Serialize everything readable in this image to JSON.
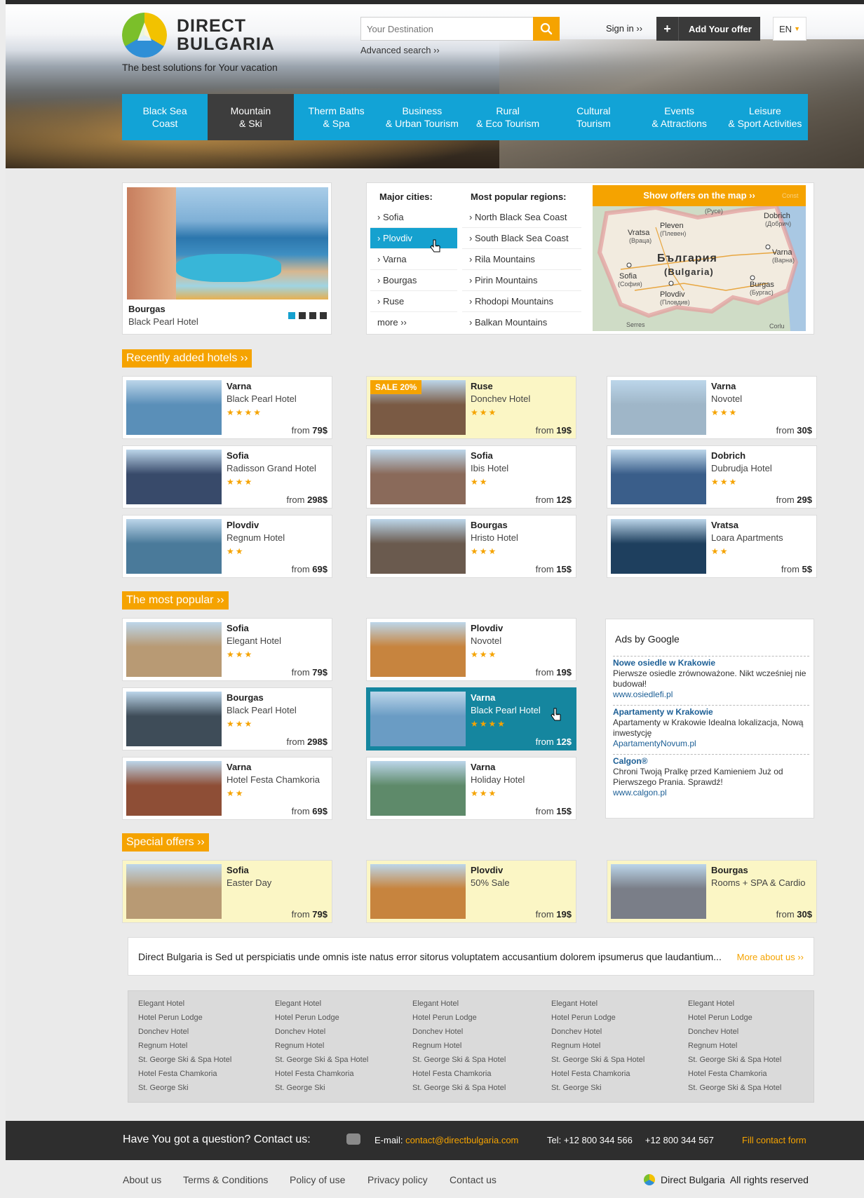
{
  "header": {
    "brand_line1": "DIRECT",
    "brand_line2": "BULGARIA",
    "tagline": "The best solutions for Your vacation",
    "search_placeholder": "Your Destination",
    "advanced_search": "Advanced search ››",
    "sign_in": "Sign in ››",
    "add_offer": "Add Your offer",
    "language": "EN"
  },
  "nav": [
    {
      "line1": "Black Sea",
      "line2": "Coast"
    },
    {
      "line1": "Mountain",
      "line2": "& Ski"
    },
    {
      "line1": "Therm Baths",
      "line2": "& Spa"
    },
    {
      "line1": "Business",
      "line2": "& Urban Tourism"
    },
    {
      "line1": "Rural",
      "line2": "& Eco Tourism"
    },
    {
      "line1": "Cultural",
      "line2": "Tourism"
    },
    {
      "line1": "Events",
      "line2": "& Attractions"
    },
    {
      "line1": "Leisure",
      "line2": "& Sport Activities"
    }
  ],
  "featured": {
    "city": "Bourgas",
    "hotel": "Black Pearl Hotel",
    "slides": 4,
    "active_slide": 1
  },
  "cities": {
    "heading": "Major cities:",
    "items": [
      "› Sofia",
      "› Plovdiv",
      "› Varna",
      "› Bourgas",
      "› Ruse",
      "more ››"
    ],
    "selected": "› Plovdiv"
  },
  "regions": {
    "heading": "Most popular regions:",
    "items": [
      "› North Black Sea Coast",
      "› South Black Sea Coast",
      "› Rila Mountains",
      "› Pirin Mountains",
      "› Rhodopi Mountains",
      "› Balkan Mountains"
    ]
  },
  "map": {
    "button": "Show offers on the map ››",
    "country": "България",
    "country_en": "(Bulgaria)",
    "labels": [
      "Pleven",
      "(Плевен)",
      "Vratsa",
      "(Враца)",
      "Dobrich",
      "(Добрич)",
      "Varna",
      "(Варна)",
      "Sofia",
      "(София)",
      "Plovdiv",
      "(Пловдив)",
      "Burgas",
      "(Бургас)",
      "Serres",
      "Corlu",
      "(Русе)",
      "Const"
    ]
  },
  "sections": {
    "recent": "Recently added hotels ››",
    "popular": "The most popular ››",
    "special": "Special offers ››"
  },
  "recent_hotels": [
    {
      "city": "Varna",
      "name": "Black Pearl Hotel",
      "stars": "★★★★",
      "from": "from ",
      "price": "79$",
      "bg": "#5a8fb8"
    },
    {
      "city": "Ruse",
      "name": "Donchev Hotel",
      "stars": "★★★",
      "from": "from ",
      "price": "19$",
      "badge": "SALE 20%",
      "bg": "#7a5a44"
    },
    {
      "city": "Varna",
      "name": "Novotel",
      "stars": "★★★",
      "from": "from ",
      "price": "30$",
      "bg": "#9fb6c8"
    },
    {
      "city": "Sofia",
      "name": "Radisson Grand Hotel",
      "stars": "★★★",
      "from": "from ",
      "price": "298$",
      "bg": "#384a6a"
    },
    {
      "city": "Sofia",
      "name": "Ibis Hotel",
      "stars": "★★",
      "from": "from ",
      "price": "12$",
      "bg": "#8a6a5a"
    },
    {
      "city": "Dobrich",
      "name": "Dubrudja Hotel",
      "stars": "★★★",
      "from": "from ",
      "price": "29$",
      "bg": "#3a5e8a"
    },
    {
      "city": "Plovdiv",
      "name": "Regnum Hotel",
      "stars": "★★",
      "from": "from ",
      "price": "69$",
      "bg": "#4a7a9a"
    },
    {
      "city": "Bourgas",
      "name": "Hristo Hotel",
      "stars": "★★★",
      "from": "from ",
      "price": "15$",
      "bg": "#6a5a4e"
    },
    {
      "city": "Vratsa",
      "name": "Loara Apartments",
      "stars": "★★",
      "from": "from ",
      "price": "5$",
      "bg": "#1e3f5e"
    }
  ],
  "popular_hotels": [
    {
      "city": "Sofia",
      "name": "Elegant Hotel",
      "stars": "★★★",
      "from": "from ",
      "price": "79$",
      "bg": "#b89a74"
    },
    {
      "city": "Plovdiv",
      "name": "Novotel",
      "stars": "★★★",
      "from": "from ",
      "price": "19$",
      "bg": "#c7843e"
    },
    {
      "city": "Bourgas",
      "name": "Black Pearl Hotel",
      "stars": "★★★",
      "from": "from ",
      "price": "298$",
      "bg": "#3e4c58"
    },
    {
      "city": "Varna",
      "name": "Black Pearl Hotel",
      "stars": "★★★★",
      "from": "from ",
      "price": "12$",
      "bg": "#6a9cc4"
    },
    {
      "city": "Varna",
      "name": "Hotel Festa Chamkoria",
      "stars": "★★",
      "from": "from ",
      "price": "69$",
      "bg": "#8e4e36"
    },
    {
      "city": "Varna",
      "name": "Holiday Hotel",
      "stars": "★★★",
      "from": "from ",
      "price": "15$",
      "bg": "#5e8a6a"
    }
  ],
  "ads": {
    "heading": "Ads by Google",
    "items": [
      {
        "title": "Nowe osiedle w Krakowie",
        "text": "Pierwsze osiedle zrównoważone. Nikt wcześniej nie budował!",
        "url": "www.osiedlefi.pl"
      },
      {
        "title": "Apartamenty w Krakowie",
        "text": "Apartamenty w Krakowie Idealna lokalizacja, Nową inwestycję",
        "url": "ApartamentyNovum.pl"
      },
      {
        "title": "Calgon®",
        "text": "Chroni Twoją Pralkę przed Kamieniem Już od Pierwszego Prania. Sprawdź!",
        "url": "www.calgon.pl"
      }
    ]
  },
  "special_offers": [
    {
      "city": "Sofia",
      "name": "Easter Day",
      "from": "from ",
      "price": "79$",
      "bg": "#b89a74"
    },
    {
      "city": "Plovdiv",
      "name": "50% Sale",
      "from": "from ",
      "price": "19$",
      "bg": "#c7843e"
    },
    {
      "city": "Bourgas",
      "name": "Rooms + SPA & Cardio",
      "from": "from ",
      "price": "30$",
      "bg": "#7a7e88"
    }
  ],
  "about": {
    "text": "Direct Bulgaria  is Sed ut perspiciatis unde omnis iste natus error sitorus voluptatem accusantium dolorem ipsumerus que laudantium...",
    "more": "More about us ››"
  },
  "link_columns": [
    [
      "Elegant Hotel",
      "Hotel Perun Lodge",
      "Donchev Hotel",
      "Regnum Hotel",
      "St. George Ski & Spa Hotel",
      "Hotel Festa Chamkoria",
      "St. George Ski"
    ],
    [
      "Elegant Hotel",
      "Hotel Perun Lodge",
      "Donchev Hotel",
      "Regnum Hotel",
      "St. George Ski & Spa Hotel",
      "Hotel Festa Chamkoria",
      "St. George Ski"
    ],
    [
      "Elegant Hotel",
      "Hotel Perun Lodge",
      "Donchev Hotel",
      "Regnum Hotel",
      "St. George Ski & Spa Hotel",
      "Hotel Festa Chamkoria",
      "St. George Ski & Spa Hotel"
    ],
    [
      "Elegant Hotel",
      "Hotel Perun Lodge",
      "Donchev Hotel",
      "Regnum Hotel",
      "St. George Ski & Spa Hotel",
      "Hotel Festa Chamkoria",
      "St. George Ski"
    ],
    [
      "Elegant Hotel",
      "Hotel Perun Lodge",
      "Donchev Hotel",
      "Regnum Hotel",
      "St. George Ski & Spa Hotel",
      "Hotel Festa Chamkoria",
      "St. George Ski & Spa Hotel"
    ]
  ],
  "contact": {
    "question": "Have You got a question? Contact us:",
    "email_label": "E-mail: ",
    "email": "contact@directbulgaria.com",
    "tel": "Tel: +12 800 344 566     +12 800 344 567",
    "fill_form": "Fill contact form"
  },
  "footer": {
    "links": [
      "About us",
      "Terms & Conditions",
      "Policy of use",
      "Privacy policy",
      "Contact us"
    ],
    "brand": "Direct Bulgaria",
    "rights": "All rights reserved"
  },
  "colors": {
    "accent": "#f5a300",
    "nav_blue": "#12a3d6",
    "highlight": "#15869f",
    "dark": "#2e2e2e"
  }
}
